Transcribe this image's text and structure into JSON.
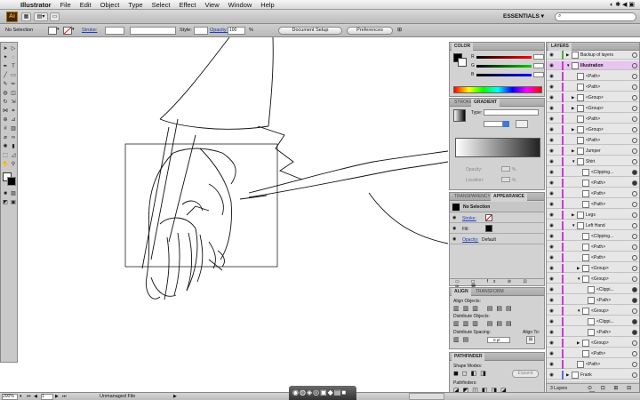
{
  "menubar": {
    "app": "Illustrator",
    "items": [
      "File",
      "Edit",
      "Object",
      "Type",
      "Select",
      "Effect",
      "View",
      "Window",
      "Help"
    ]
  },
  "appbar": {
    "logo": "Ai",
    "workspace": "ESSENTIALS"
  },
  "control": {
    "selection": "No Selection",
    "stroke_label": "Stroke:",
    "style_label": "Style:",
    "opacity_label": "Opacity:",
    "opacity_value": "100",
    "opacity_unit": "%",
    "doc_setup": "Document Setup",
    "preferences": "Preferences"
  },
  "color_panel": {
    "tab": "COLOR",
    "r": "R",
    "g": "G",
    "b": "B"
  },
  "stroke_panel": {
    "tab1": "STROKE",
    "tab2": "GRADIENT",
    "type_label": "Type:",
    "opacity_label": "Opacity:",
    "location_label": "Location:",
    "pct": "%"
  },
  "appearance_panel": {
    "tab1": "TRANSPARENCY",
    "tab2": "APPEARANCE",
    "title": "No Selection",
    "rows": [
      {
        "label": "Stroke:",
        "link": true
      },
      {
        "label": "Fill:",
        "link": false
      },
      {
        "label": "Opacity:",
        "value": "Default"
      }
    ]
  },
  "align_panel": {
    "tab1": "ALIGN",
    "tab2": "TRANSFORM",
    "align_objects": "Align Objects:",
    "distribute_objects": "Distribute Objects:",
    "distribute_spacing": "Distribute Spacing:",
    "align_to": "Align To:",
    "spacing_value": "0 pt"
  },
  "pathfinder_panel": {
    "tab": "PATHFINDER",
    "shape_modes": "Shape Modes:",
    "pathfinders": "Pathfinders:",
    "expand": "Expand"
  },
  "layers_panel": {
    "tab": "LAYERS",
    "footer": "3 Layers",
    "rows": [
      {
        "name": "Backup of layers",
        "indent": 0,
        "tw": "▶",
        "bar": "#5aa84a",
        "sel": false,
        "target": false
      },
      {
        "name": "Illustration",
        "indent": 0,
        "tw": "▼",
        "bar": "#cc3bd0",
        "sel": true,
        "target": false
      },
      {
        "name": "<Path>",
        "indent": 1,
        "tw": "",
        "bar": "#cc3bd0",
        "sel": false,
        "target": false
      },
      {
        "name": "<Path>",
        "indent": 1,
        "tw": "",
        "bar": "#cc3bd0",
        "sel": false,
        "target": false
      },
      {
        "name": "<Group>",
        "indent": 1,
        "tw": "▶",
        "bar": "#cc3bd0",
        "sel": false,
        "target": false
      },
      {
        "name": "<Group>",
        "indent": 1,
        "tw": "▶",
        "bar": "#cc3bd0",
        "sel": false,
        "target": false
      },
      {
        "name": "<Path>",
        "indent": 1,
        "tw": "",
        "bar": "#cc3bd0",
        "sel": false,
        "target": false
      },
      {
        "name": "<Group>",
        "indent": 1,
        "tw": "▶",
        "bar": "#cc3bd0",
        "sel": false,
        "target": false
      },
      {
        "name": "<Path>",
        "indent": 1,
        "tw": "",
        "bar": "#cc3bd0",
        "sel": false,
        "target": false
      },
      {
        "name": "Jumper",
        "indent": 1,
        "tw": "▶",
        "bar": "#cc3bd0",
        "sel": false,
        "target": false
      },
      {
        "name": "Shirt",
        "indent": 1,
        "tw": "▼",
        "bar": "#cc3bd0",
        "sel": false,
        "target": false
      },
      {
        "name": "<Clipping...",
        "indent": 2,
        "tw": "",
        "bar": "#cc3bd0",
        "sel": false,
        "target": true
      },
      {
        "name": "<Path>",
        "indent": 2,
        "tw": "",
        "bar": "#cc3bd0",
        "sel": false,
        "target": true
      },
      {
        "name": "<Path>",
        "indent": 2,
        "tw": "",
        "bar": "#cc3bd0",
        "sel": false,
        "target": false
      },
      {
        "name": "<Path>",
        "indent": 2,
        "tw": "",
        "bar": "#cc3bd0",
        "sel": false,
        "target": false
      },
      {
        "name": "Legs",
        "indent": 1,
        "tw": "▶",
        "bar": "#cc3bd0",
        "sel": false,
        "target": false
      },
      {
        "name": "Left Hand",
        "indent": 1,
        "tw": "▼",
        "bar": "#cc3bd0",
        "sel": false,
        "target": false
      },
      {
        "name": "<Clipping...",
        "indent": 2,
        "tw": "",
        "bar": "#cc3bd0",
        "sel": false,
        "target": false
      },
      {
        "name": "<Path>",
        "indent": 2,
        "tw": "",
        "bar": "#cc3bd0",
        "sel": false,
        "target": false
      },
      {
        "name": "<Path>",
        "indent": 2,
        "tw": "",
        "bar": "#cc3bd0",
        "sel": false,
        "target": false
      },
      {
        "name": "<Group>",
        "indent": 2,
        "tw": "▶",
        "bar": "#cc3bd0",
        "sel": false,
        "target": false
      },
      {
        "name": "<Group>",
        "indent": 2,
        "tw": "▼",
        "bar": "#cc3bd0",
        "sel": false,
        "target": false
      },
      {
        "name": "<Clippi...",
        "indent": 3,
        "tw": "",
        "bar": "#cc3bd0",
        "sel": false,
        "target": true
      },
      {
        "name": "<Path>",
        "indent": 3,
        "tw": "",
        "bar": "#cc3bd0",
        "sel": false,
        "target": true
      },
      {
        "name": "<Group>",
        "indent": 2,
        "tw": "▼",
        "bar": "#cc3bd0",
        "sel": false,
        "target": false
      },
      {
        "name": "<Clippi...",
        "indent": 3,
        "tw": "",
        "bar": "#cc3bd0",
        "sel": false,
        "target": true
      },
      {
        "name": "<Path>",
        "indent": 3,
        "tw": "",
        "bar": "#cc3bd0",
        "sel": false,
        "target": true
      },
      {
        "name": "<Group>",
        "indent": 2,
        "tw": "▶",
        "bar": "#cc3bd0",
        "sel": false,
        "target": false
      },
      {
        "name": "<Path>",
        "indent": 2,
        "tw": "",
        "bar": "#cc3bd0",
        "sel": false,
        "target": false
      },
      {
        "name": "<Path>",
        "indent": 1,
        "tw": "",
        "bar": "#cc3bd0",
        "sel": false,
        "target": false
      },
      {
        "name": "Frank",
        "indent": 0,
        "tw": "▶",
        "bar": "#5a6fd8",
        "sel": false,
        "target": false
      }
    ]
  },
  "status": {
    "zoom": "200%",
    "page": "1",
    "file_status": "Unmanaged File"
  }
}
